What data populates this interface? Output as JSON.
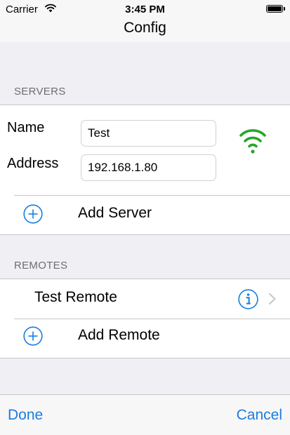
{
  "status_bar": {
    "carrier": "Carrier",
    "time": "3:45 PM",
    "wifi_icon": "wifi-icon",
    "battery_level": 1.0
  },
  "nav": {
    "title": "Config"
  },
  "servers": {
    "header": "SERVERS",
    "name_label": "Name",
    "name_value": "Test",
    "address_label": "Address",
    "address_value": "192.168.1.80",
    "status_icon": "wifi-signal-icon",
    "status_color": "#2aa52a",
    "add_label": "Add Server",
    "add_icon": "add-circle-icon"
  },
  "remotes": {
    "header": "REMOTES",
    "items": [
      {
        "label": "Test Remote",
        "info_icon": "info-icon",
        "disclosure_icon": "chevron-right-icon"
      }
    ],
    "add_label": "Add Remote",
    "add_icon": "add-circle-icon"
  },
  "toolbar": {
    "done_label": "Done",
    "cancel_label": "Cancel"
  },
  "colors": {
    "accent": "#1a7dde",
    "background": "#efeff4",
    "separator": "#c8c7cc",
    "section_header": "#6d6d72",
    "success": "#2aa52a"
  }
}
